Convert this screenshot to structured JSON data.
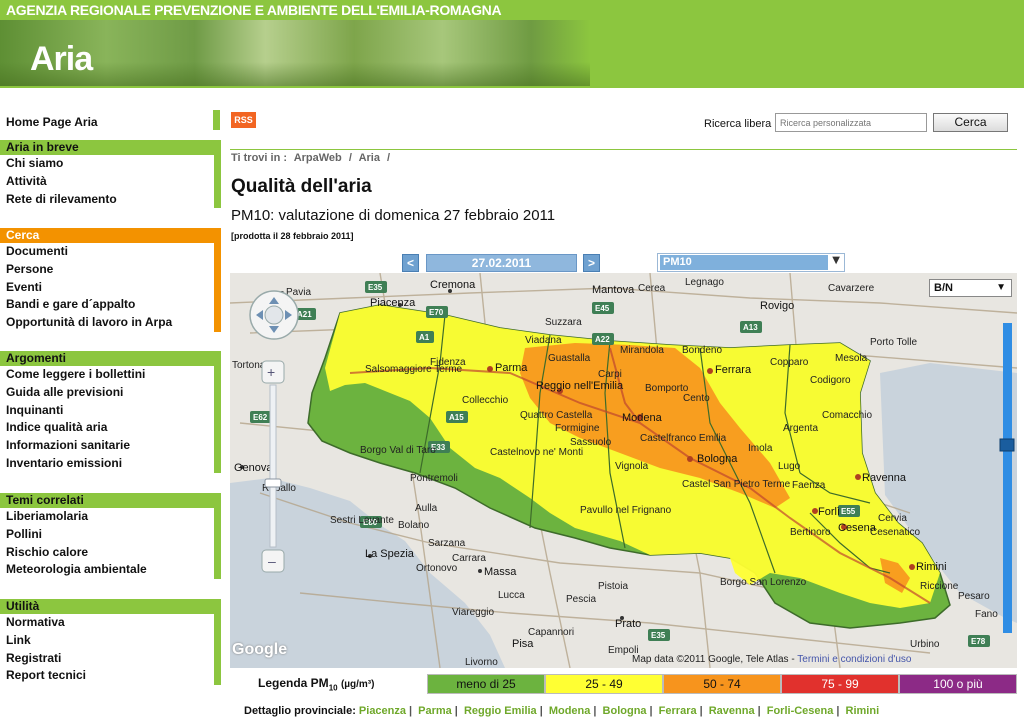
{
  "banner": {
    "agency": "AGENZIA REGIONALE PREVENZIONE E AMBIENTE DELL'EMILIA-ROMAGNA",
    "app_name": "Aria"
  },
  "colors": {
    "brand_green": "#8cc63f",
    "nav_orange": "#f39200",
    "rss": "#f26522",
    "link_green": "#6fa82a"
  },
  "nav": {
    "home": "Home Page Aria",
    "groups": [
      {
        "title": "Aria in breve",
        "items": [
          "Chi siamo",
          "Attività",
          "Rete di rilevamento"
        ]
      },
      {
        "title": "Cerca",
        "items": [
          "Documenti",
          "Persone",
          "Eventi",
          "Bandi e gare d´appalto",
          "Opportunità di lavoro in Arpa"
        ]
      },
      {
        "title": "Argomenti",
        "items": [
          "Come leggere i bollettini",
          "Guida alle previsioni",
          "Inquinanti",
          "Indice qualità aria",
          "Informazioni sanitarie",
          "Inventario emissioni"
        ]
      },
      {
        "title": "Temi correlati",
        "items": [
          "Liberiamolaria",
          "Pollini",
          "Rischio calore",
          "Meteorologia ambientale"
        ]
      },
      {
        "title": "Utilità",
        "items": [
          "Normativa",
          "Link",
          "Registrati",
          "Report tecnici"
        ]
      }
    ]
  },
  "toolbar": {
    "rss": "RSS",
    "search_label": "Ricerca libera",
    "search_placeholder": "Ricerca personalizzata",
    "search_logo": "Google™",
    "search_button": "Cerca"
  },
  "breadcrumb": [
    "Ti trovi in :",
    "ArpaWeb",
    "/",
    "Aria",
    "/"
  ],
  "page": {
    "title": "Qualità dell'aria",
    "subtitle": "PM10: valutazione di domenica 27 febbraio 2011",
    "produced": "[prodotta il 28 febbraio 2011]"
  },
  "controls": {
    "prev": "<",
    "date": "27.02.2011",
    "next": ">",
    "pollutant": "PM10",
    "map_type": "B/N"
  },
  "map": {
    "attribution": "Map data ©2011 Google, Tele Atlas -",
    "terms": "Termini e condizioni d'uso",
    "google": "Google",
    "cities": [
      "Pavia",
      "Piacenza",
      "Cremona",
      "Mantova",
      "Cerea",
      "Legnago",
      "Rovigo",
      "Cavarzere",
      "Porto Tolle",
      "Tortona",
      "Suzzara",
      "Viadana",
      "Parma",
      "Guastalla",
      "Carpi",
      "Mirandola",
      "Bondeno",
      "Ferrara",
      "Copparo",
      "Codigoro",
      "Mesola",
      "Salsomaggiore Terme",
      "Fidenza",
      "Reggio nell'Emilia",
      "Bomporto",
      "Cento",
      "Collecchio",
      "Quattro Castella",
      "Modena",
      "Castelfranco Emilia",
      "Argenta",
      "Comacchio",
      "Formigine",
      "Sassuolo",
      "Bologna",
      "Vignola",
      "Genova",
      "Borgo Val di Taro",
      "Castelnovo ne' Monti",
      "Imola",
      "Lugo",
      "Ravenna",
      "Rapallo",
      "Pontremoli",
      "Castel San Pietro Terme",
      "Faenza",
      "Cervia",
      "Forlì",
      "Sestri Levante",
      "Bolano",
      "Aulla",
      "Pavullo nel Frignano",
      "Cesena",
      "Cesenatico",
      "Bertinoro",
      "La Spezia",
      "Sarzana",
      "Ortonovo",
      "Carrara",
      "Massa",
      "Rimini",
      "Riccione",
      "Viareggio",
      "Pistoia",
      "Prato",
      "Borgo San Lorenzo",
      "Pesaro",
      "Fano",
      "Urbino",
      "Pisa",
      "Lucca",
      "Capannori",
      "Pescia",
      "Empoli",
      "Livorno"
    ],
    "roads": [
      "E35",
      "A21",
      "A1",
      "E70",
      "E45",
      "A22",
      "A13",
      "E62",
      "A12",
      "E33",
      "A15",
      "E80",
      "A14",
      "E55",
      "E78"
    ]
  },
  "legend": {
    "label": "Legenda PM",
    "label_sub": "10",
    "unit": "(µg/m³)",
    "classes": [
      {
        "label": "meno di 25",
        "color": "#6cb33f"
      },
      {
        "label": "25 - 49",
        "color": "#ffff33"
      },
      {
        "label": "50 - 74",
        "color": "#f7941d"
      },
      {
        "label": "75 - 99",
        "color": "#e1312d"
      },
      {
        "label": "100 o più",
        "color": "#8c2a86"
      }
    ]
  },
  "provinces": {
    "label": "Dettaglio provinciale:",
    "items": [
      "Piacenza",
      "Parma",
      "Reggio Emilia",
      "Modena",
      "Bologna",
      "Ferrara",
      "Ravenna",
      "Forli-Cesena",
      "Rimini"
    ]
  }
}
